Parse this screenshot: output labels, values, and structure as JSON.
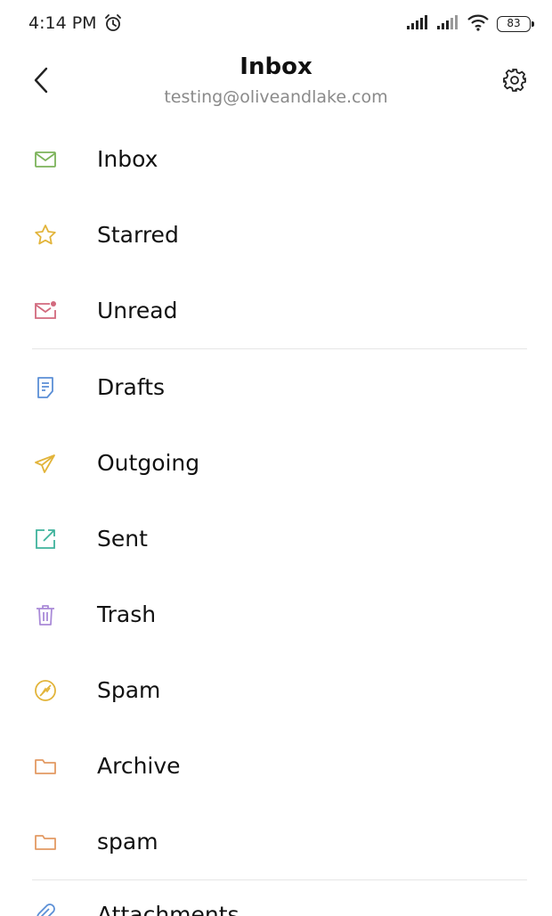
{
  "status": {
    "time": "4:14 PM",
    "battery": "83"
  },
  "header": {
    "title": "Inbox",
    "account": "testing@oliveandlake.com"
  },
  "menu": {
    "inbox": "Inbox",
    "starred": "Starred",
    "unread": "Unread",
    "drafts": "Drafts",
    "outgoing": "Outgoing",
    "sent": "Sent",
    "trash": "Trash",
    "spam": "Spam",
    "archive": "Archive",
    "spam_folder": "spam",
    "attachments": "Attachments"
  },
  "icons": {
    "inbox": "mail-icon",
    "starred": "star-icon",
    "unread": "unread-mail-icon",
    "drafts": "draft-icon",
    "outgoing": "paper-plane-icon",
    "sent": "sent-icon",
    "trash": "trash-icon",
    "spam": "spam-icon",
    "archive": "folder-icon",
    "spam_folder": "folder-icon",
    "attachments": "attachment-icon"
  },
  "colors": {
    "inbox": "#7cb35a",
    "starred": "#e2b43a",
    "unread": "#d26a7e",
    "drafts": "#5b8fd6",
    "outgoing": "#e2b43a",
    "sent": "#3fb39c",
    "trash": "#a98ad8",
    "spam": "#e2b43a",
    "folder": "#e39a63"
  }
}
